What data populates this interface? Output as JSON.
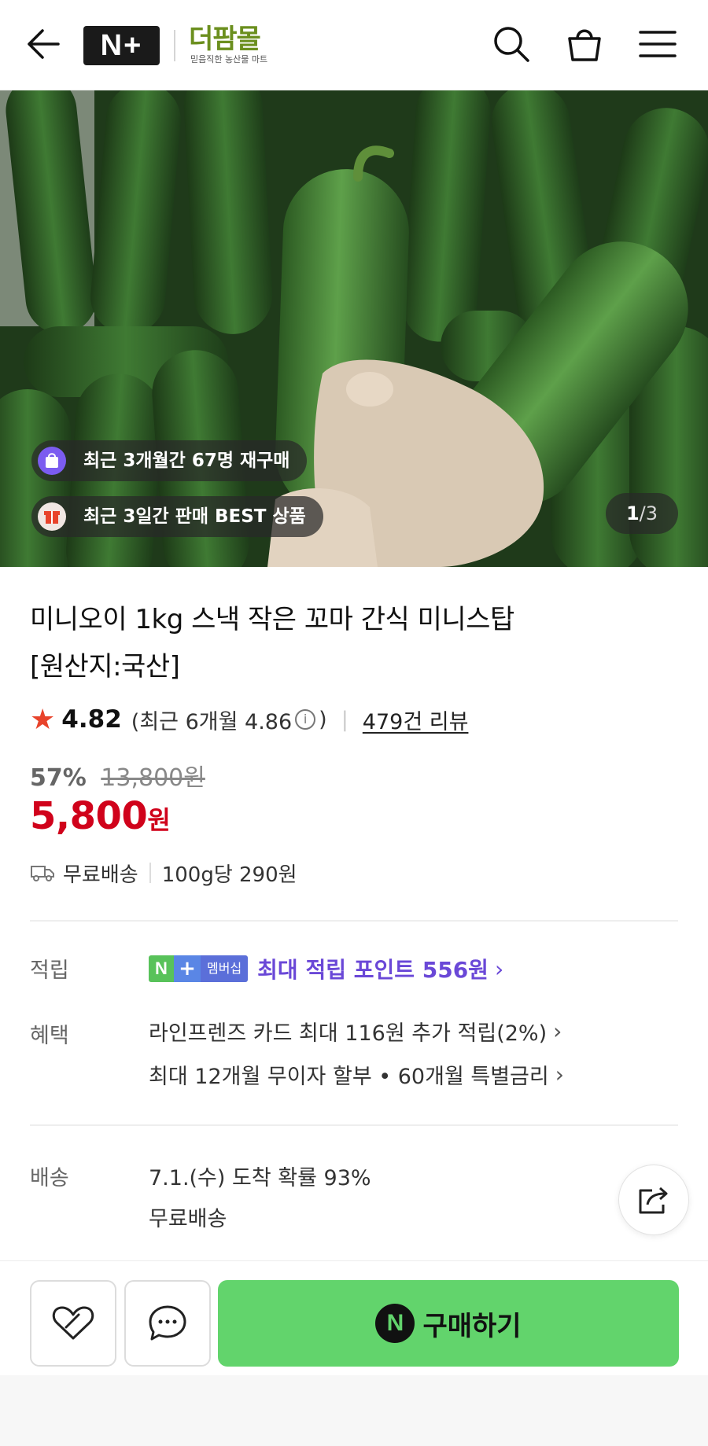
{
  "header": {
    "logo_mark": "N+",
    "logo_name": "더팜몰",
    "logo_tagline": "믿음직한 농산물 마트",
    "icons": [
      "back-arrow-icon",
      "search-icon",
      "shopping-bag-icon",
      "hamburger-menu-icon"
    ]
  },
  "hero": {
    "badge_repurchase": "최근 3개월간 67명 재구매",
    "badge_best": "최근 3일간 판매 BEST 상품",
    "counter_current": "1",
    "counter_total": "/3"
  },
  "product": {
    "title_line1": "미니오이 1kg 스낵 작은 꼬마 간식 미니스탑",
    "title_line2": "[원산지:국산]",
    "rating": "4.82",
    "recent_rating_prefix": "(최근 6개월 4.86",
    "recent_rating_suffix": ")",
    "review_link": "479건 리뷰",
    "discount_pct": "57%",
    "original_price": "13,800원",
    "price": "5,800",
    "price_unit": "원",
    "free_shipping": "무료배송",
    "unit_price": "100g당 290원"
  },
  "details": {
    "points_label": "적립",
    "member_n": "N",
    "member_plus": "+",
    "member_text": "멤버십",
    "points_text": "최대 적립 포인트 556원",
    "benefit_label": "혜택",
    "benefit_1": "라인프렌즈 카드 최대 116원 추가 적립(2%)",
    "benefit_2": "최대 12개월 무이자 할부 • 60개월 특별금리",
    "delivery_label": "배송",
    "delivery_1": "7.1.(수) 도착 확률 93%",
    "delivery_2": "무료배송"
  },
  "bottom_bar": {
    "buy_n": "N",
    "buy_label": "구매하기"
  },
  "colors": {
    "price_red": "#d0021b",
    "buy_green": "#62d46c",
    "points_purple": "#6a48d7",
    "star_red": "#e8432b",
    "logo_green": "#6b8f1e"
  }
}
